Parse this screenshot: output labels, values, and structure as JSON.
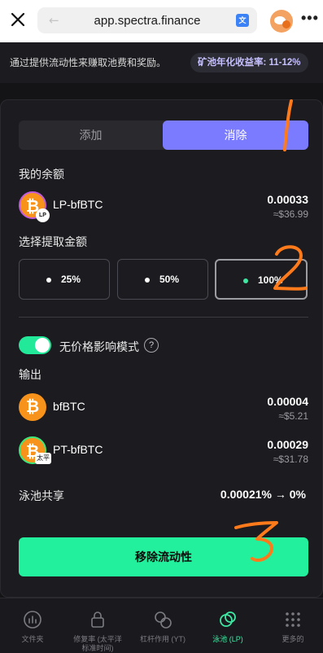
{
  "browser": {
    "url": "app.spectra.finance",
    "back_glyph": "←",
    "translate_glyph": "文"
  },
  "promo": {
    "text": "通过提供流动性来赚取池费和奖励。",
    "badge": "矿池年化收益率: 11-12%"
  },
  "tabs": {
    "add": "添加",
    "remove": "消除"
  },
  "balance": {
    "label": "我的余额",
    "token": "LP-bfBTC",
    "amount": "0.00033",
    "usd": "≈$36.99",
    "lp_badge": "LP"
  },
  "withdraw": {
    "label": "选择提取金额",
    "options": [
      "25%",
      "50%",
      "100%"
    ],
    "selected": "100%"
  },
  "no_price_impact": {
    "label": "无价格影响模式",
    "enabled": true
  },
  "output": {
    "label": "输出",
    "items": [
      {
        "token": "bfBTC",
        "amount": "0.00004",
        "usd": "≈$5.21"
      },
      {
        "token": "PT-bfBTC",
        "amount": "0.00029",
        "usd": "≈$31.78",
        "badge": "太平"
      }
    ]
  },
  "pool_share": {
    "label": "泳池共享",
    "value": "0.00021% → 0%"
  },
  "cta": "移除流动性",
  "annotations": [
    "1",
    "2",
    "3"
  ],
  "nav": [
    {
      "label": "文件夹",
      "icon": "chart-circle-icon"
    },
    {
      "label": "修复率 (太平洋标准时间)",
      "icon": "lock-icon"
    },
    {
      "label": "杠杆作用 (YT)",
      "icon": "yt-icon"
    },
    {
      "label": "泳池 (LP)",
      "icon": "pool-icon",
      "active": true
    },
    {
      "label": "更多的",
      "icon": "grid-icon"
    }
  ],
  "colors": {
    "accent_purple": "#7b7bff",
    "accent_green": "#23f09c",
    "bitcoin_orange": "#f7931a",
    "annotation_orange": "#ff7a1a"
  }
}
